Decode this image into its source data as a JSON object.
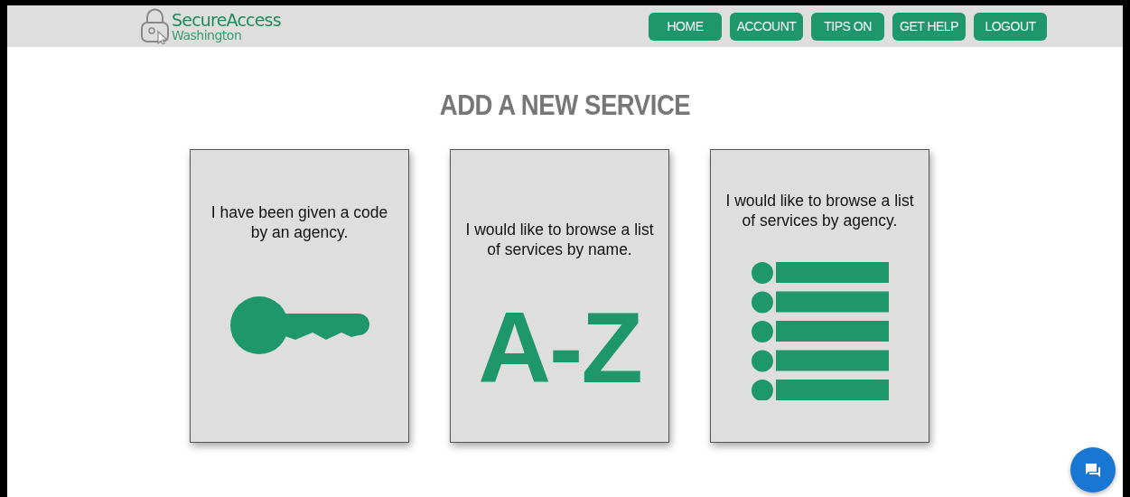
{
  "header": {
    "logo": {
      "title": "SecureAccess",
      "subtitle": "Washington"
    },
    "nav": [
      {
        "label": "HOME"
      },
      {
        "label": "ACCOUNT"
      },
      {
        "label": "TIPS ON"
      },
      {
        "label": "GET HELP"
      },
      {
        "label": "LOGOUT"
      }
    ]
  },
  "heading": "ADD A NEW SERVICE",
  "cards": [
    {
      "kind": "key",
      "text": "I have been given a code by an agency."
    },
    {
      "kind": "letters",
      "text": "I would like to browse a list of services by name.",
      "letters": "A-Z"
    },
    {
      "kind": "list",
      "text": "I would like to browse a list of services by agency."
    }
  ],
  "chat_button": {
    "kind": "chat"
  }
}
